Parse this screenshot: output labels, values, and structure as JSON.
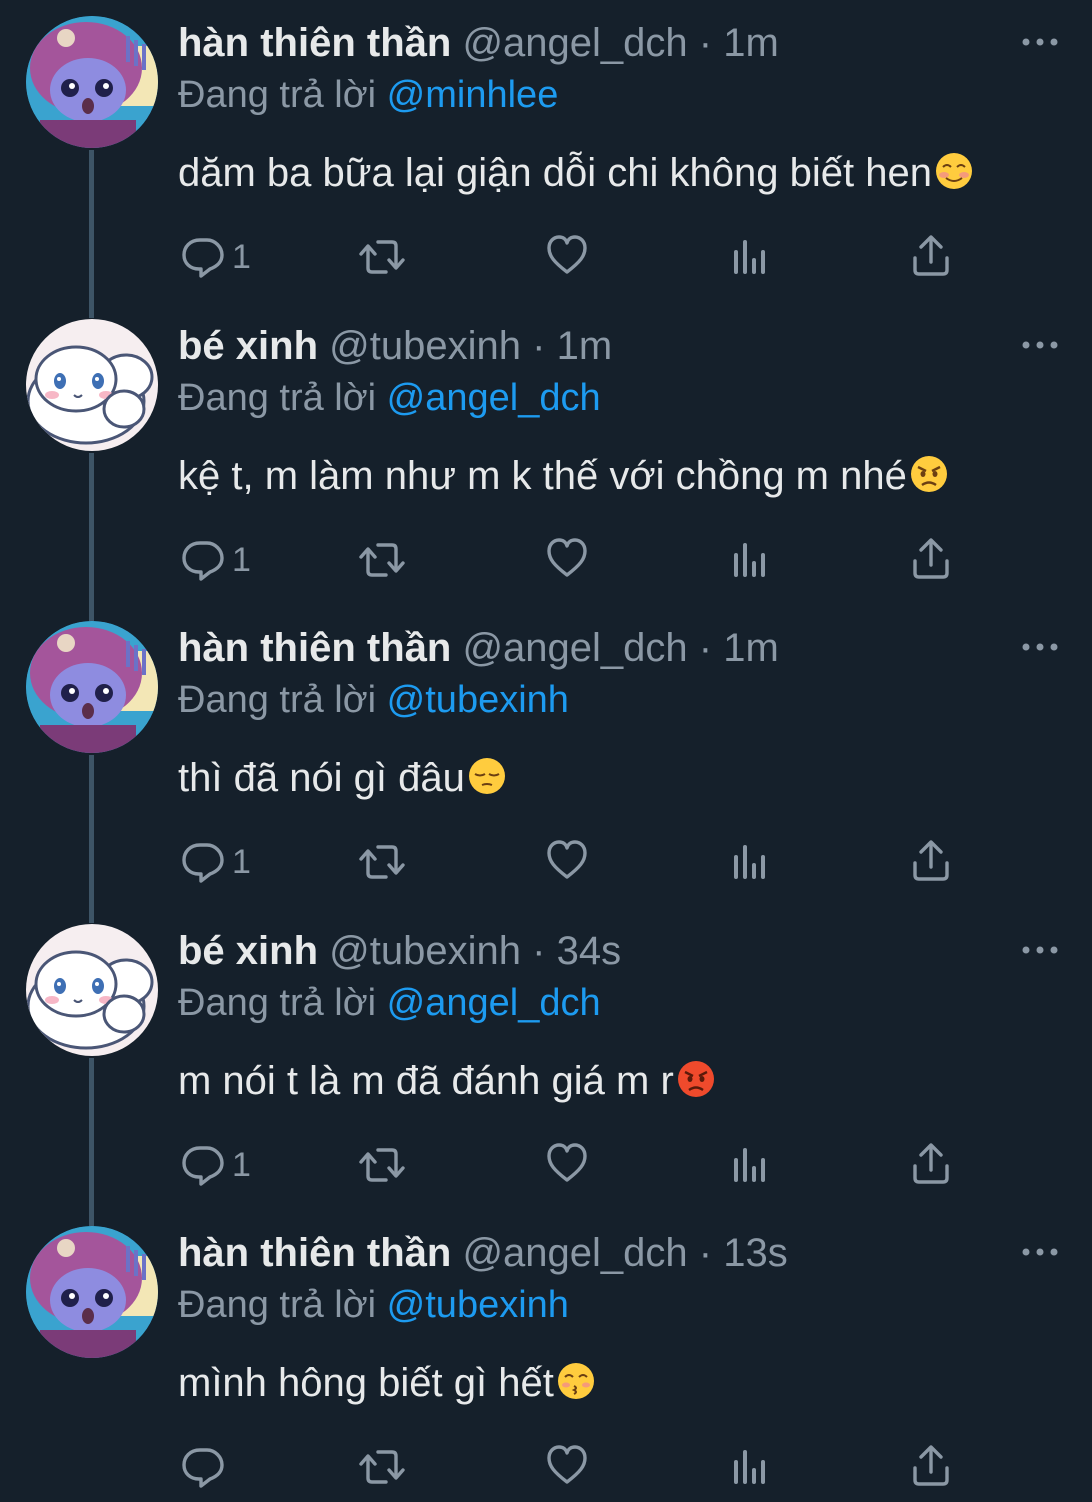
{
  "replying_prefix": "Đang trả lời",
  "colors": {
    "background": "#15202b",
    "text": "#e7e9ea",
    "muted": "#8b98a5",
    "mention": "#1d9bf0",
    "thread_line": "#3d5466"
  },
  "tweets": [
    {
      "avatar": "purple-hood-character",
      "name": "hàn thiên thần",
      "handle": "@angel_dch",
      "separator": "·",
      "time": "1m",
      "replying_to": "@minhlee",
      "text": "dăm ba bữa lại giận dỗi chi không biết hen",
      "emoji": "smiling-blush-emoji",
      "reply_count": "1"
    },
    {
      "avatar": "white-puppy-character",
      "name": "bé xinh",
      "handle": "@tubexinh",
      "separator": "·",
      "time": "1m",
      "replying_to": "@angel_dch",
      "text": "kệ t, m làm như m k thế với chồng m nhé",
      "emoji": "angry-face-emoji",
      "reply_count": "1"
    },
    {
      "avatar": "purple-hood-character",
      "name": "hàn thiên thần",
      "handle": "@angel_dch",
      "separator": "·",
      "time": "1m",
      "replying_to": "@tubexinh",
      "text": "thì đã nói gì đâu",
      "emoji": "pensive-face-emoji",
      "reply_count": "1"
    },
    {
      "avatar": "white-puppy-character",
      "name": "bé xinh",
      "handle": "@tubexinh",
      "separator": "·",
      "time": "34s",
      "replying_to": "@angel_dch",
      "text": "m nói t là m đã đánh giá m r",
      "emoji": "pouting-red-face-emoji",
      "reply_count": "1"
    },
    {
      "avatar": "purple-hood-character",
      "name": "hàn thiên thần",
      "handle": "@angel_dch",
      "separator": "·",
      "time": "13s",
      "replying_to": "@tubexinh",
      "text": "mình hông biết gì hết",
      "emoji": "kissing-face-emoji",
      "reply_count": ""
    }
  ]
}
